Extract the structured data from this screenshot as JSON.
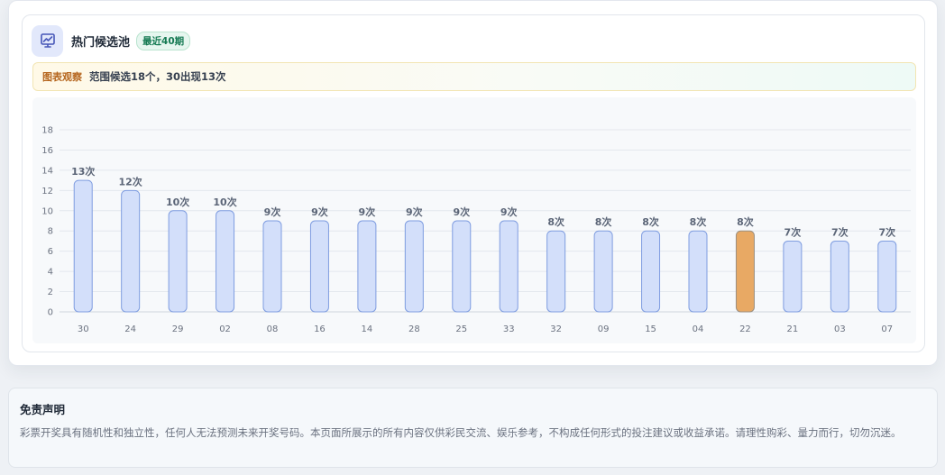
{
  "panel": {
    "icon": "trend-chart-icon",
    "title": "热门候选池",
    "badge": "最近40期",
    "notice_tag": "图表观察",
    "notice_text": "范围候选18个，30出现13次"
  },
  "chart_data": {
    "type": "bar",
    "categories": [
      "30",
      "24",
      "29",
      "02",
      "08",
      "16",
      "14",
      "28",
      "25",
      "33",
      "32",
      "09",
      "15",
      "04",
      "22",
      "21",
      "03",
      "07"
    ],
    "values": [
      13,
      12,
      10,
      10,
      9,
      9,
      9,
      9,
      9,
      9,
      8,
      8,
      8,
      8,
      8,
      7,
      7,
      7
    ],
    "data_labels": [
      "13次",
      "12次",
      "10次",
      "10次",
      "9次",
      "9次",
      "9次",
      "9次",
      "9次",
      "9次",
      "8次",
      "8次",
      "8次",
      "8次",
      "8次",
      "7次",
      "7次",
      "7次"
    ],
    "highlight_category": "22",
    "ylim": [
      0,
      18
    ],
    "yticks": [
      0,
      2,
      4,
      6,
      8,
      10,
      12,
      14,
      16,
      18
    ],
    "grid": true,
    "colors": {
      "bar_fill": "#d3dffa",
      "bar_stroke": "#7f9de0",
      "highlight_fill": "#e8a964",
      "highlight_stroke": "#9b8f80",
      "grid": "#e4e8ee",
      "label": "#6b7280"
    }
  },
  "disclaimer": {
    "title": "免责声明",
    "text": "彩票开奖具有随机性和独立性，任何人无法预测未来开奖号码。本页面所展示的所有内容仅供彩民交流、娱乐参考，不构成任何形式的投注建议或收益承诺。请理性购彩、量力而行，切勿沉迷。"
  }
}
